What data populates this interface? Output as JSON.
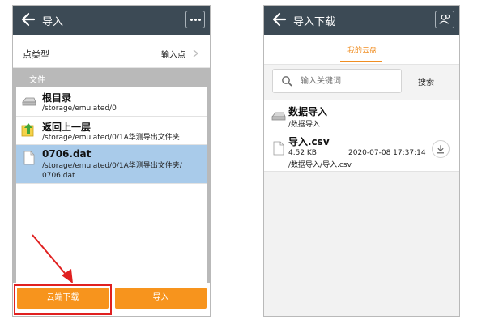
{
  "left": {
    "title": "导入",
    "point_type_label": "点类型",
    "point_type_value": "输入点",
    "files_header": "文件",
    "files": [
      {
        "name": "根目录",
        "path": "/storage/emulated/0",
        "icon": "drive-icon",
        "selected": false
      },
      {
        "name": "返回上一层",
        "path": "/storage/emulated/0/1A华测导出文件夹",
        "icon": "folder-up-icon",
        "selected": false
      },
      {
        "name": "0706.dat",
        "path_line1": "/storage/emulated/0/1A华测导出文件夹/",
        "path_line2": "0706.dat",
        "icon": "file-icon",
        "selected": true
      }
    ],
    "cloud_download_label": "云端下载",
    "import_label": "导入"
  },
  "right": {
    "title": "导入下载",
    "tab_label": "我的云盘",
    "search_placeholder": "输入关键词",
    "search_button": "搜索",
    "items": [
      {
        "name": "数据导入",
        "path": "/数据导入",
        "icon": "drive-icon"
      },
      {
        "name": "导入.csv",
        "size": "4.52 KB",
        "date": "2020-07-08 17:37:14",
        "path": "/数据导入/导入.csv",
        "icon": "file-icon"
      }
    ]
  },
  "colors": {
    "appbar": "#3c4a55",
    "accent": "#f7941d",
    "selected_row": "#a9cbea",
    "highlight": "#e02020"
  }
}
